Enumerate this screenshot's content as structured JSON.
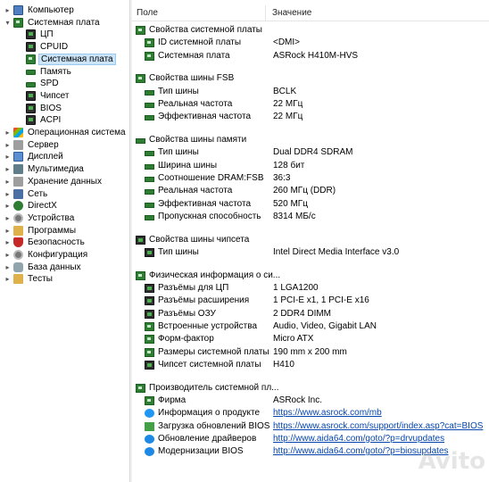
{
  "tree": [
    {
      "label": "Компьютер",
      "icon": "monitor-icon",
      "expander": "▸",
      "level": 0
    },
    {
      "label": "Системная плата",
      "icon": "board-icon",
      "expander": "▾",
      "level": 0
    },
    {
      "label": "ЦП",
      "icon": "chip-icon",
      "expander": "",
      "level": 1
    },
    {
      "label": "CPUID",
      "icon": "chip-icon",
      "expander": "",
      "level": 1
    },
    {
      "label": "Системная плата",
      "icon": "board-icon",
      "expander": "",
      "level": 1,
      "selected": true
    },
    {
      "label": "Память",
      "icon": "memory-icon",
      "expander": "",
      "level": 1
    },
    {
      "label": "SPD",
      "icon": "memory-icon",
      "expander": "",
      "level": 1
    },
    {
      "label": "Чипсет",
      "icon": "chip-icon",
      "expander": "",
      "level": 1
    },
    {
      "label": "BIOS",
      "icon": "chip-icon",
      "expander": "",
      "level": 1
    },
    {
      "label": "ACPI",
      "icon": "chip-icon",
      "expander": "",
      "level": 1
    },
    {
      "label": "Операционная система",
      "icon": "windows-icon",
      "expander": "▸",
      "level": 0
    },
    {
      "label": "Сервер",
      "icon": "server-icon",
      "expander": "▸",
      "level": 0
    },
    {
      "label": "Дисплей",
      "icon": "display-icon",
      "expander": "▸",
      "level": 0
    },
    {
      "label": "Мультимедиа",
      "icon": "speaker-icon",
      "expander": "▸",
      "level": 0
    },
    {
      "label": "Хранение данных",
      "icon": "storage-icon",
      "expander": "▸",
      "level": 0
    },
    {
      "label": "Сеть",
      "icon": "network-icon",
      "expander": "▸",
      "level": 0
    },
    {
      "label": "DirectX",
      "icon": "directx-icon",
      "expander": "▸",
      "level": 0
    },
    {
      "label": "Устройства",
      "icon": "devices-icon",
      "expander": "▸",
      "level": 0
    },
    {
      "label": "Программы",
      "icon": "programs-icon",
      "expander": "▸",
      "level": 0
    },
    {
      "label": "Безопасность",
      "icon": "security-icon",
      "expander": "▸",
      "level": 0
    },
    {
      "label": "Конфигурация",
      "icon": "config-icon",
      "expander": "▸",
      "level": 0
    },
    {
      "label": "База данных",
      "icon": "database-icon",
      "expander": "▸",
      "level": 0
    },
    {
      "label": "Тесты",
      "icon": "tests-icon",
      "expander": "▸",
      "level": 0
    }
  ],
  "list_header": {
    "field": "Поле",
    "value": "Значение"
  },
  "rows": [
    {
      "type": "sec",
      "field": "Свойства системной платы",
      "value": "",
      "icon": "board-icon"
    },
    {
      "type": "item",
      "field": "ID системной платы",
      "value": "<DMI>",
      "icon": "board-icon"
    },
    {
      "type": "item",
      "field": "Системная плата",
      "value": "ASRock H410M-HVS",
      "icon": "board-icon"
    },
    {
      "type": "gap"
    },
    {
      "type": "sec",
      "field": "Свойства шины FSB",
      "value": "",
      "icon": "board-icon"
    },
    {
      "type": "item",
      "field": "Тип шины",
      "value": "BCLK",
      "icon": "memory-icon"
    },
    {
      "type": "item",
      "field": "Реальная частота",
      "value": "22 МГц",
      "icon": "memory-icon"
    },
    {
      "type": "item",
      "field": "Эффективная частота",
      "value": "22 МГц",
      "icon": "memory-icon"
    },
    {
      "type": "gap"
    },
    {
      "type": "sec",
      "field": "Свойства шины памяти",
      "value": "",
      "icon": "memory-icon"
    },
    {
      "type": "item",
      "field": "Тип шины",
      "value": "Dual DDR4 SDRAM",
      "icon": "memory-icon"
    },
    {
      "type": "item",
      "field": "Ширина шины",
      "value": "128 бит",
      "icon": "memory-icon"
    },
    {
      "type": "item",
      "field": "Соотношение DRAM:FSB",
      "value": "36:3",
      "icon": "memory-icon"
    },
    {
      "type": "item",
      "field": "Реальная частота",
      "value": "260 МГц (DDR)",
      "icon": "memory-icon"
    },
    {
      "type": "item",
      "field": "Эффективная частота",
      "value": "520 МГц",
      "icon": "memory-icon"
    },
    {
      "type": "item",
      "field": "Пропускная способность",
      "value": "8314 МБ/с",
      "icon": "memory-icon"
    },
    {
      "type": "gap"
    },
    {
      "type": "sec",
      "field": "Свойства шины чипсета",
      "value": "",
      "icon": "chip-icon"
    },
    {
      "type": "item",
      "field": "Тип шины",
      "value": "Intel Direct Media Interface v3.0",
      "icon": "chip-icon"
    },
    {
      "type": "gap"
    },
    {
      "type": "sec",
      "field": "Физическая информация о си...",
      "value": "",
      "icon": "board-icon"
    },
    {
      "type": "item",
      "field": "Разъёмы для ЦП",
      "value": "1 LGA1200",
      "icon": "chip-icon"
    },
    {
      "type": "item",
      "field": "Разъёмы расширения",
      "value": "1 PCI-E x1, 1 PCI-E x16",
      "icon": "chip-icon"
    },
    {
      "type": "item",
      "field": "Разъёмы ОЗУ",
      "value": "2 DDR4 DIMM",
      "icon": "chip-icon"
    },
    {
      "type": "item",
      "field": "Встроенные устройства",
      "value": "Audio, Video, Gigabit LAN",
      "icon": "board-icon"
    },
    {
      "type": "item",
      "field": "Форм-фактор",
      "value": "Micro ATX",
      "icon": "board-icon"
    },
    {
      "type": "item",
      "field": "Размеры системной платы",
      "value": "190 mm x 200 mm",
      "icon": "board-icon"
    },
    {
      "type": "item",
      "field": "Чипсет системной платы",
      "value": "H410",
      "icon": "chip-icon"
    },
    {
      "type": "gap"
    },
    {
      "type": "sec",
      "field": "Производитель системной пл...",
      "value": "",
      "icon": "board-icon"
    },
    {
      "type": "item",
      "field": "Фирма",
      "value": "ASRock Inc.",
      "icon": "board-icon"
    },
    {
      "type": "item",
      "field": "Информация о продукте",
      "value": "https://www.asrock.com/mb",
      "icon": "globe-icon",
      "link": true
    },
    {
      "type": "item",
      "field": "Загрузка обновлений BIOS",
      "value": "https://www.asrock.com/support/index.asp?cat=BIOS",
      "icon": "download-icon",
      "link": true
    },
    {
      "type": "item",
      "field": "Обновление драйверов",
      "value": "http://www.aida64.com/goto/?p=drvupdates",
      "icon": "update-icon",
      "link": true
    },
    {
      "type": "item",
      "field": "Модернизации BIOS",
      "value": "http://www.aida64.com/goto/?p=biosupdates",
      "icon": "update-icon",
      "link": true
    }
  ],
  "watermark": "Avito"
}
